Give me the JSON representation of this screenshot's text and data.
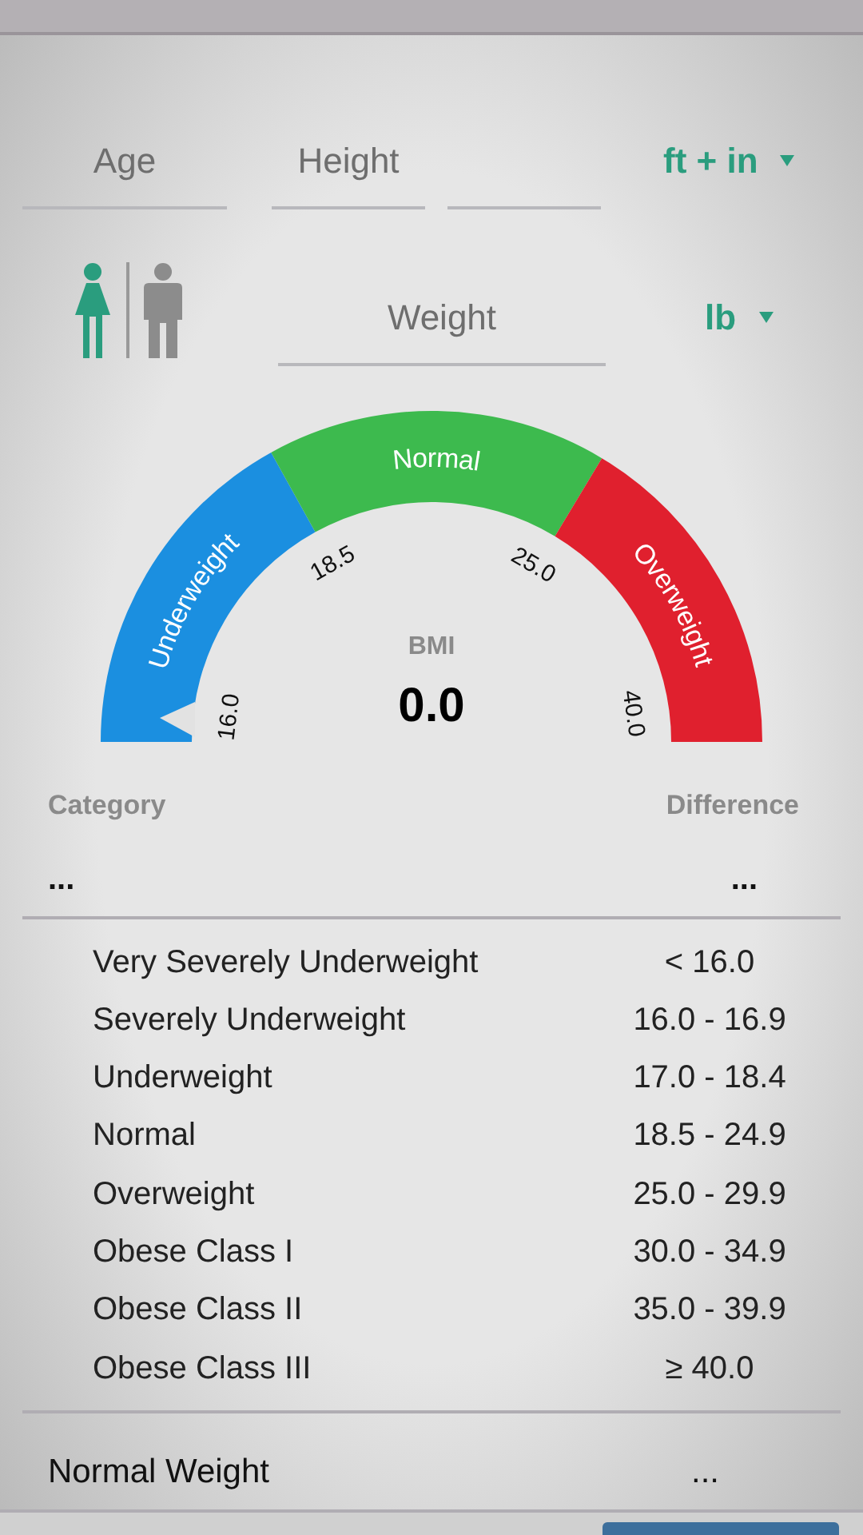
{
  "inputs": {
    "age": {
      "placeholder": "Age"
    },
    "height": {
      "placeholder": "Height"
    },
    "height_unit": "ft + in",
    "weight": {
      "placeholder": "Weight"
    },
    "weight_unit": "lb"
  },
  "genders": [
    {
      "kind": "female",
      "selected": true
    },
    {
      "kind": "male",
      "selected": false
    }
  ],
  "gauge": {
    "segments": [
      {
        "label": "Underweight",
        "color": "#1b8fe0"
      },
      {
        "label": "Normal",
        "color": "#3dba4e"
      },
      {
        "label": "Overweight",
        "color": "#e0202e"
      }
    ],
    "ticks": [
      "16.0",
      "18.5",
      "25.0",
      "40.0"
    ],
    "label": "BMI",
    "value": "0.0"
  },
  "result": {
    "columns": [
      "Category",
      "Difference"
    ],
    "values": [
      "...",
      "..."
    ]
  },
  "ranges": [
    {
      "category": "Very Severely Underweight",
      "range": "< 16.0"
    },
    {
      "category": "Severely Underweight",
      "range": "16.0 - 16.9"
    },
    {
      "category": "Underweight",
      "range": "17.0 - 18.4"
    },
    {
      "category": "Normal",
      "range": "18.5 - 24.9"
    },
    {
      "category": "Overweight",
      "range": "25.0 - 29.9"
    },
    {
      "category": "Obese Class I",
      "range": "30.0 - 34.9"
    },
    {
      "category": "Obese Class II",
      "range": "35.0 - 39.9"
    },
    {
      "category": "Obese Class III",
      "range": "≥ 40.0"
    }
  ],
  "ideal": {
    "label": "Normal Weight",
    "value": "..."
  }
}
